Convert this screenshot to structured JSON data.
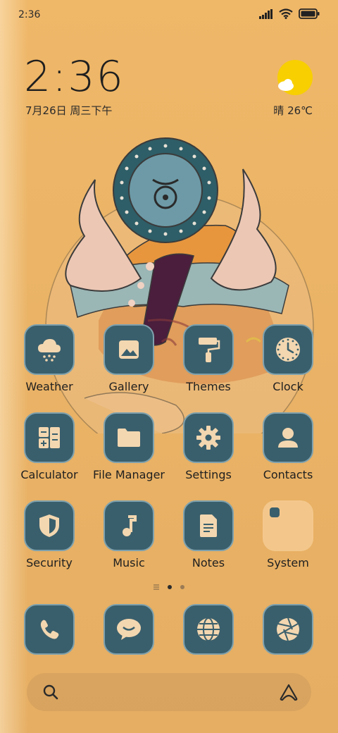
{
  "status_bar": {
    "time": "2:36",
    "icons": [
      "signal-icon",
      "wifi-icon",
      "battery-icon"
    ]
  },
  "clock_widget": {
    "time": "2:36",
    "date": "7月26日 周三下午"
  },
  "weather_widget": {
    "icon": "sun-cloud-icon",
    "text": "晴 26℃"
  },
  "apps": [
    {
      "label": "Weather",
      "icon": "weather-cloud-icon"
    },
    {
      "label": "Gallery",
      "icon": "gallery-icon"
    },
    {
      "label": "Themes",
      "icon": "paint-roller-icon"
    },
    {
      "label": "Clock",
      "icon": "clock-icon"
    },
    {
      "label": "Calculator",
      "icon": "calculator-icon"
    },
    {
      "label": "File Manager",
      "icon": "folder-icon"
    },
    {
      "label": "Settings",
      "icon": "gear-icon"
    },
    {
      "label": "Contacts",
      "icon": "person-icon"
    },
    {
      "label": "Security",
      "icon": "shield-icon"
    },
    {
      "label": "Music",
      "icon": "music-note-icon"
    },
    {
      "label": "Notes",
      "icon": "note-icon"
    },
    {
      "label": "System",
      "icon": "folder-group-icon"
    }
  ],
  "page_indicator": {
    "pages": 3,
    "current": 2
  },
  "dock": [
    {
      "icon": "phone-icon"
    },
    {
      "icon": "message-icon"
    },
    {
      "icon": "globe-icon"
    },
    {
      "icon": "camera-shutter-icon"
    }
  ],
  "search_bar": {
    "left_icon": "search-icon",
    "right_icon": "assistant-icon"
  },
  "colors": {
    "background": "#eab366",
    "icon_bg": "#3a5f6c",
    "icon_border": "#7fa1ad",
    "icon_glyph": "#f3d7b0"
  }
}
